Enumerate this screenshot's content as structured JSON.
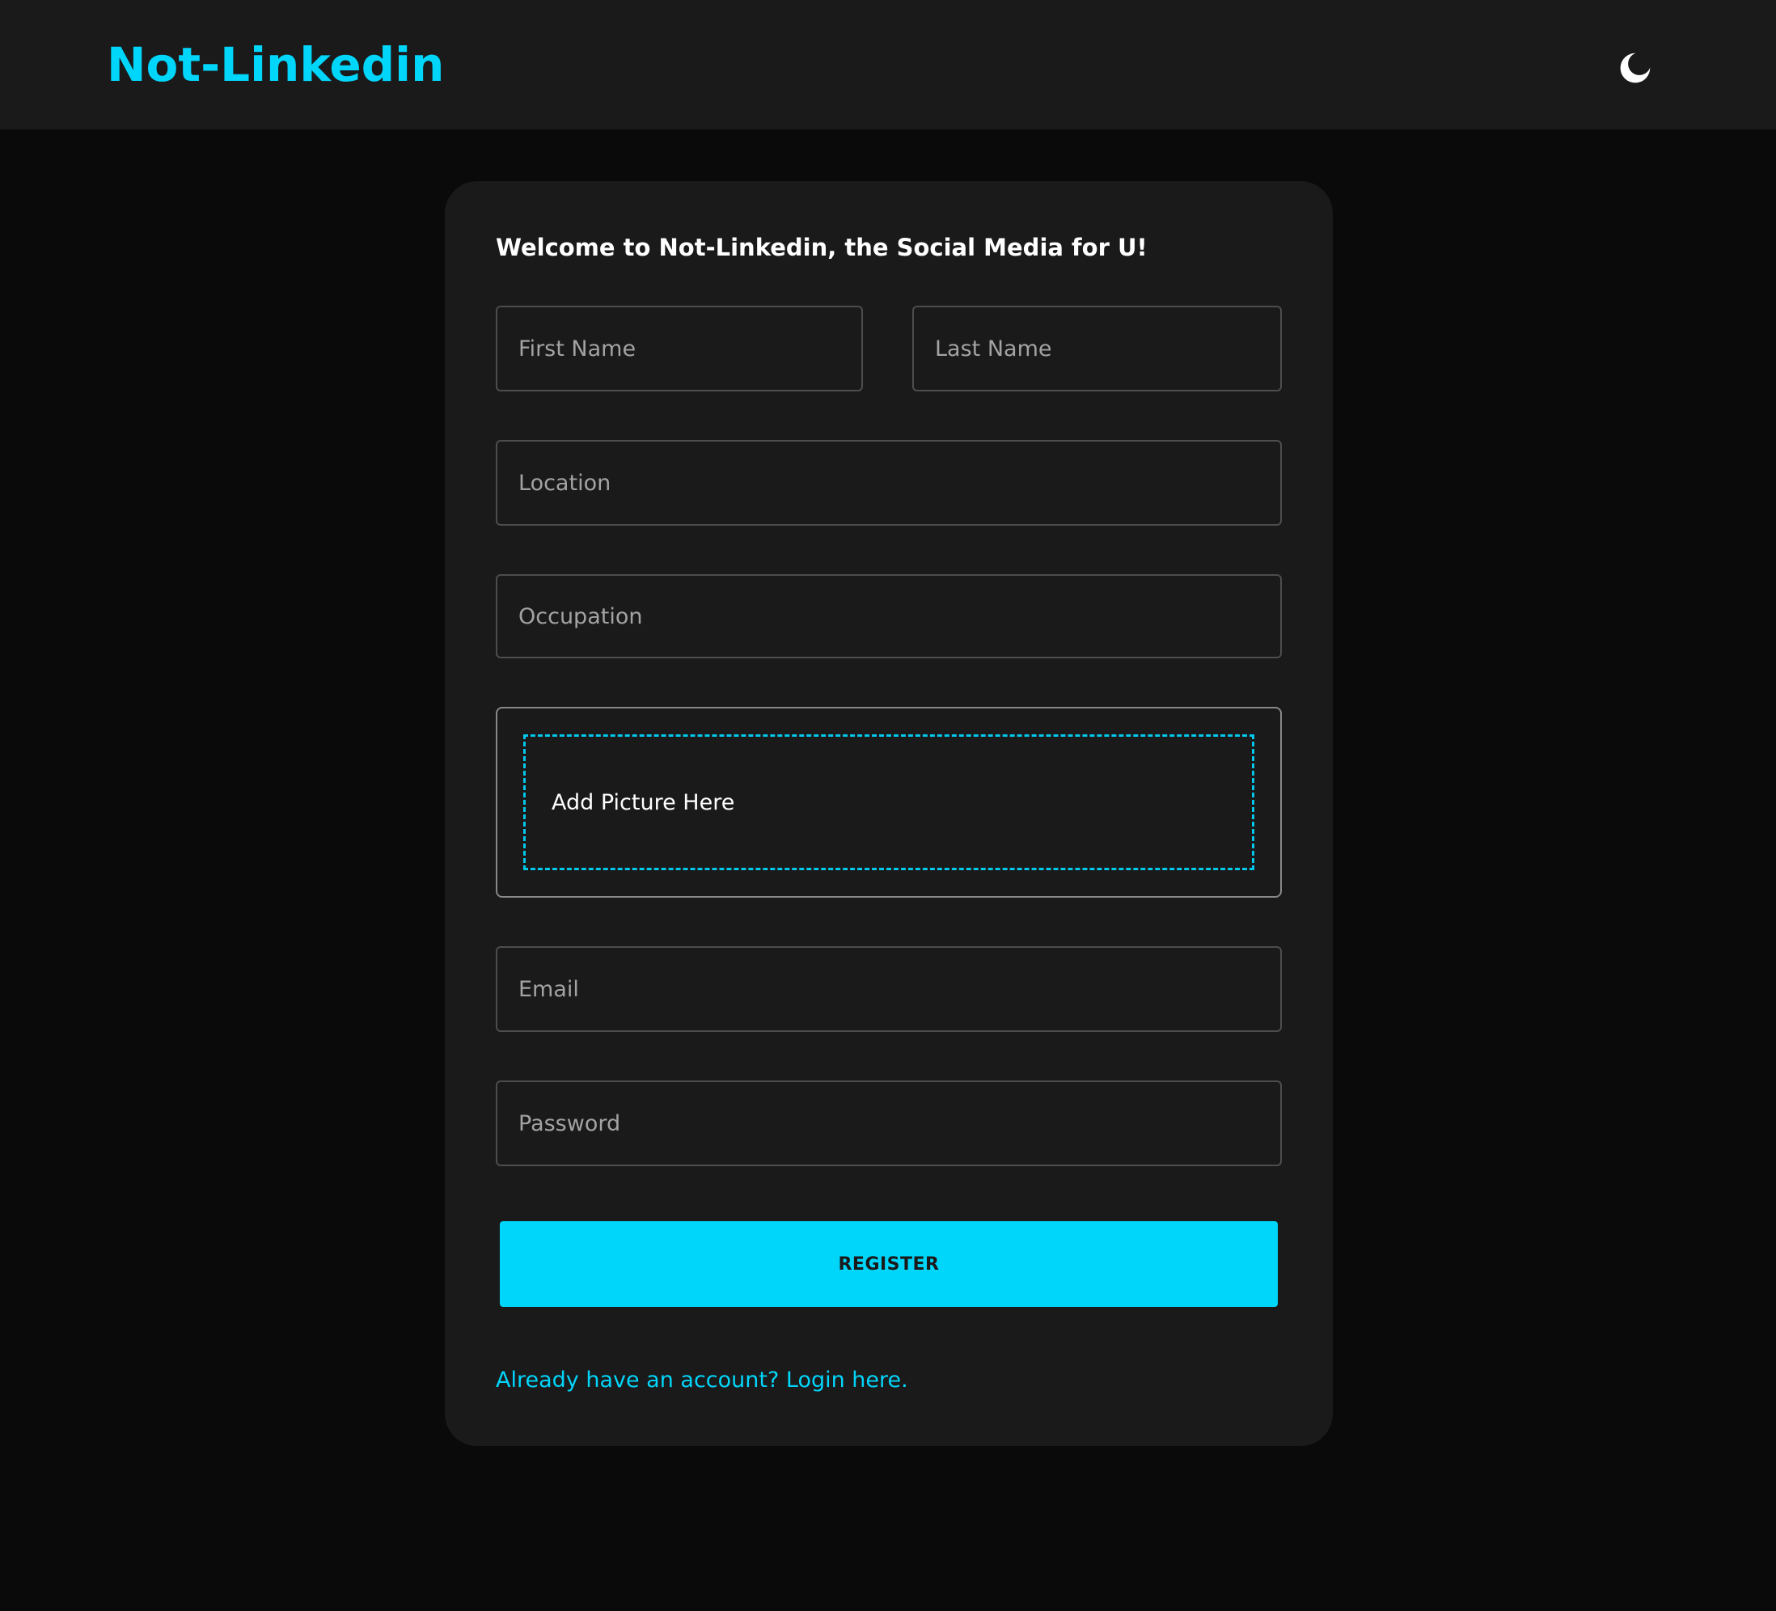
{
  "app": {
    "brand": "Not-Linkedin",
    "accent_color": "#00d5fa",
    "theme_toggle_icon": "moon-icon"
  },
  "form": {
    "welcome": "Welcome to Not-Linkedin, the Social Media for U!",
    "fields": {
      "first_name": {
        "placeholder": "First Name",
        "value": ""
      },
      "last_name": {
        "placeholder": "Last Name",
        "value": ""
      },
      "location": {
        "placeholder": "Location",
        "value": ""
      },
      "occupation": {
        "placeholder": "Occupation",
        "value": ""
      },
      "email": {
        "placeholder": "Email",
        "value": ""
      },
      "password": {
        "placeholder": "Password",
        "value": ""
      }
    },
    "picture_dropzone_label": "Add Picture Here",
    "register_label": "REGISTER",
    "login_link": "Already have an account? Login here."
  }
}
